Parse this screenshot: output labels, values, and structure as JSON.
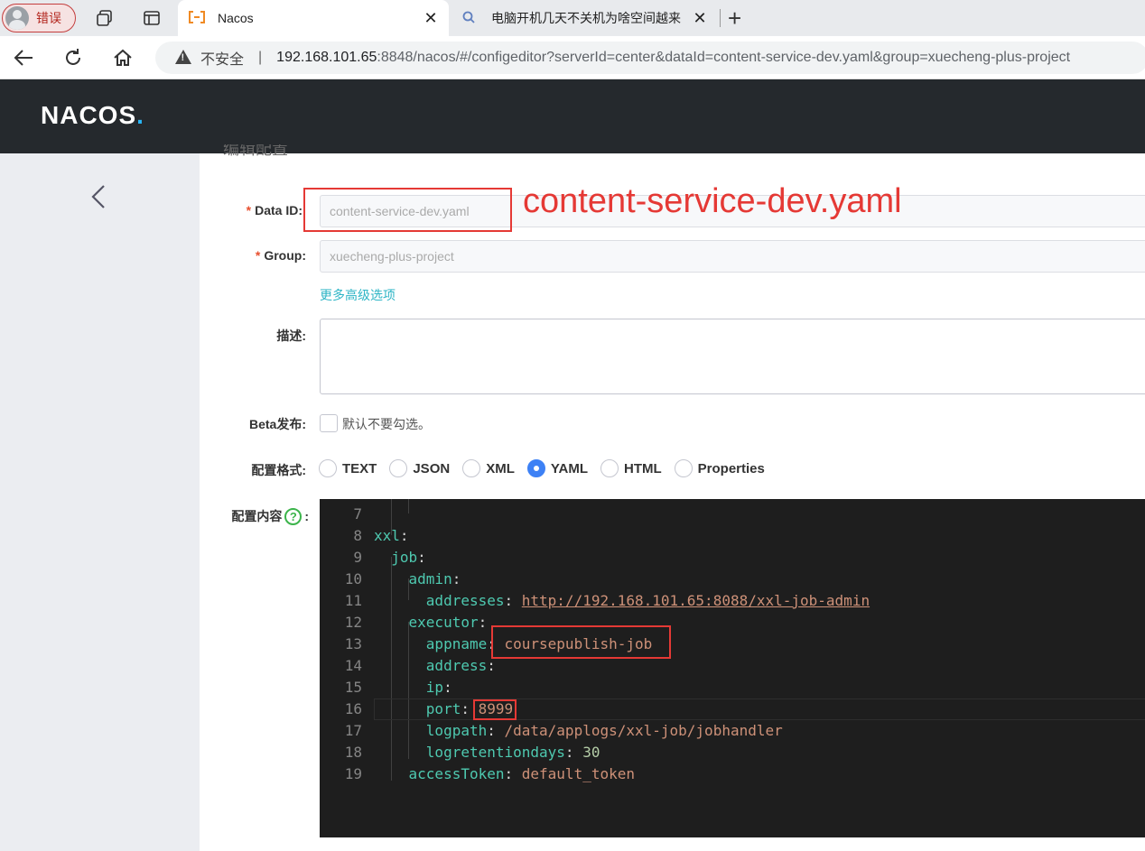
{
  "browser": {
    "profile_label": "错误",
    "tabs": [
      {
        "title": "Nacos",
        "active": true
      },
      {
        "title": "电脑开机几天不关机为啥空间越来",
        "active": false
      }
    ],
    "address": {
      "insecure_label": "不安全",
      "divider": "|",
      "host": "192.168.101.65",
      "rest": ":8848/nacos/#/configeditor?serverId=center&dataId=content-service-dev.yaml&group=xuecheng-plus-project"
    }
  },
  "app": {
    "logo": "NACOS",
    "logo_dot": ".",
    "section_title": "编辑配置"
  },
  "form": {
    "data_id_label": "Data ID:",
    "data_id_value": "content-service-dev.yaml",
    "group_label": "Group:",
    "group_value": "xuecheng-plus-project",
    "advanced_link": "更多高级选项",
    "desc_label": "描述:",
    "beta_label": "Beta发布:",
    "beta_hint": "默认不要勾选。",
    "format_label": "配置格式:",
    "formats": [
      "TEXT",
      "JSON",
      "XML",
      "YAML",
      "HTML",
      "Properties"
    ],
    "selected_format": "YAML",
    "content_label": "配置内容",
    "content_colon": ":"
  },
  "editor": {
    "lines": [
      {
        "n": "7",
        "key": "",
        "sep": "",
        "val": ""
      },
      {
        "n": "8",
        "key": "xxl",
        "sep": ":",
        "val": ""
      },
      {
        "n": "9",
        "key": "job",
        "sep": ":",
        "val": ""
      },
      {
        "n": "10",
        "key": "admin",
        "sep": ":",
        "val": ""
      },
      {
        "n": "11",
        "key": "addresses",
        "sep": ": ",
        "val": "http://192.168.101.65:8088/xxl-job-admin"
      },
      {
        "n": "12",
        "key": "executor",
        "sep": ":",
        "val": ""
      },
      {
        "n": "13",
        "key": "appname",
        "sep": ": ",
        "val": "coursepublish-job"
      },
      {
        "n": "14",
        "key": "address",
        "sep": ":",
        "val": ""
      },
      {
        "n": "15",
        "key": "ip",
        "sep": ":",
        "val": ""
      },
      {
        "n": "16",
        "key": "port",
        "sep": ": ",
        "val": "8999"
      },
      {
        "n": "17",
        "key": "logpath",
        "sep": ": ",
        "val": "/data/applogs/xxl-job/jobhandler"
      },
      {
        "n": "18",
        "key": "logretentiondays",
        "sep": ": ",
        "val": "30"
      },
      {
        "n": "19",
        "key": "accessToken",
        "sep": ": ",
        "val": "default_token"
      }
    ]
  },
  "annotation": {
    "text": "content-service-dev.yaml",
    "color": "#e53935"
  }
}
